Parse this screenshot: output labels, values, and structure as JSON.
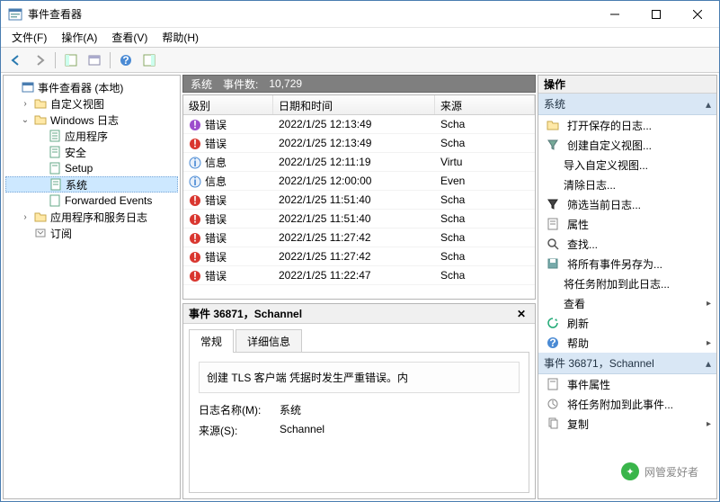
{
  "window": {
    "title": "事件查看器"
  },
  "menu": {
    "file": "文件(F)",
    "action": "操作(A)",
    "view": "查看(V)",
    "help": "帮助(H)"
  },
  "tree": {
    "root": "事件查看器 (本地)",
    "custom_views": "自定义视图",
    "windows_logs": "Windows 日志",
    "app": "应用程序",
    "security": "安全",
    "setup": "Setup",
    "system": "系统",
    "forwarded": "Forwarded Events",
    "app_svc_logs": "应用程序和服务日志",
    "subscriptions": "订阅"
  },
  "center": {
    "header_label": "系统",
    "count_label": "事件数:",
    "count_value": "10,729",
    "columns": {
      "level": "级别",
      "datetime": "日期和时间",
      "source": "来源"
    },
    "rows": [
      {
        "icon": "error-purple",
        "level": "错误",
        "dt": "2022/1/25 12:13:49",
        "src": "Scha"
      },
      {
        "icon": "error",
        "level": "错误",
        "dt": "2022/1/25 12:13:49",
        "src": "Scha"
      },
      {
        "icon": "info",
        "level": "信息",
        "dt": "2022/1/25 12:11:19",
        "src": "Virtu"
      },
      {
        "icon": "info",
        "level": "信息",
        "dt": "2022/1/25 12:00:00",
        "src": "Even"
      },
      {
        "icon": "error",
        "level": "错误",
        "dt": "2022/1/25 11:51:40",
        "src": "Scha"
      },
      {
        "icon": "error",
        "level": "错误",
        "dt": "2022/1/25 11:51:40",
        "src": "Scha"
      },
      {
        "icon": "error",
        "level": "错误",
        "dt": "2022/1/25 11:27:42",
        "src": "Scha"
      },
      {
        "icon": "error",
        "level": "错误",
        "dt": "2022/1/25 11:27:42",
        "src": "Scha"
      },
      {
        "icon": "error",
        "level": "错误",
        "dt": "2022/1/25 11:22:47",
        "src": "Scha"
      }
    ]
  },
  "detail": {
    "title": "事件 36871，Schannel",
    "tab_general": "常规",
    "tab_details": "详细信息",
    "message": "创建 TLS 客户端 凭据时发生严重错误。内",
    "log_name_label": "日志名称(M):",
    "log_name_value": "系统",
    "source_label": "来源(S):",
    "source_value": "Schannel"
  },
  "actions": {
    "title": "操作",
    "group_system": "系统",
    "open_saved": "打开保存的日志...",
    "create_custom": "创建自定义视图...",
    "import_custom": "导入自定义视图...",
    "clear_log": "清除日志...",
    "filter_current": "筛选当前日志...",
    "properties": "属性",
    "find": "查找...",
    "save_all": "将所有事件另存为...",
    "attach_task_log": "将任务附加到此日志...",
    "view": "查看",
    "refresh": "刷新",
    "help": "帮助",
    "group_event": "事件 36871，Schannel",
    "event_props": "事件属性",
    "attach_task_event": "将任务附加到此事件...",
    "copy": "复制"
  },
  "watermark": "网管爱好者"
}
